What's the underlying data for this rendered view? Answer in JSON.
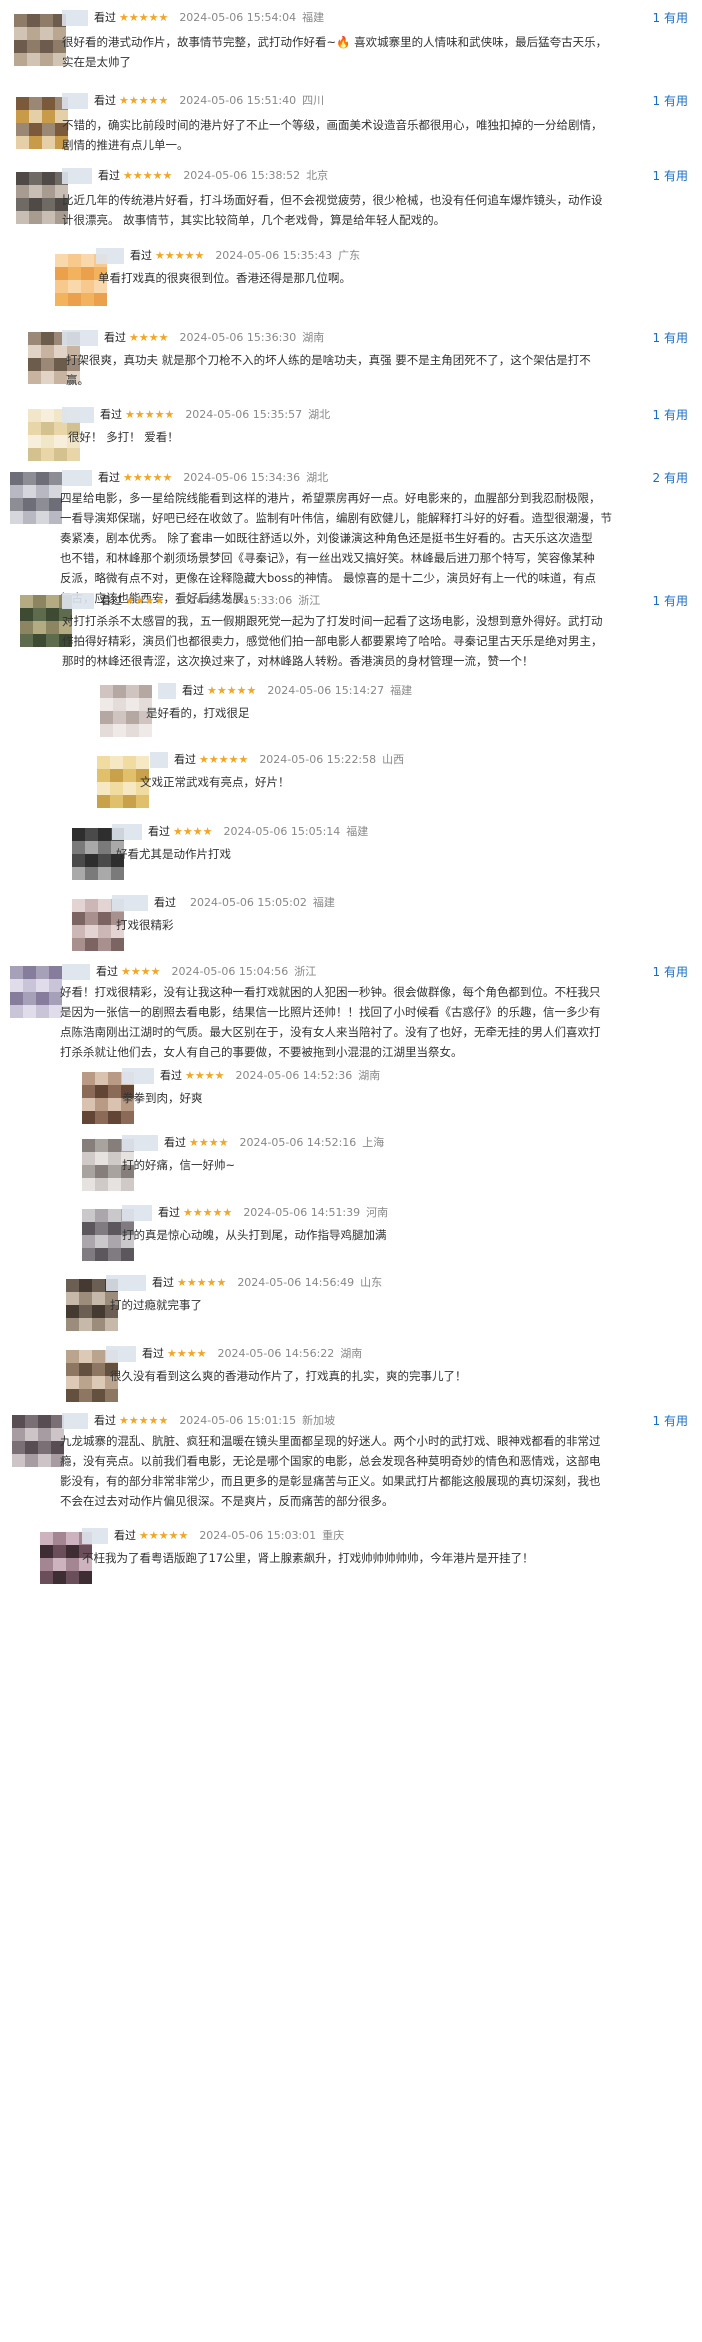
{
  "seen_label": "看过",
  "comments": [
    {
      "stars": "★★★★★",
      "time": "2024-05-06 15:54:04",
      "location": "福建",
      "useful": "1 有用",
      "lines": [
        "很好看的港式动作片，故事情节完整，武打动作好看~🔥 喜欢城寨里的人情味和武侠味，最后猛夸古天乐，",
        "实在是太帅了"
      ]
    },
    {
      "stars": "★★★★★",
      "time": "2024-05-06 15:51:40",
      "location": "四川",
      "useful": "1 有用",
      "lines": [
        "不错的，确实比前段时间的港片好了不止一个等级，画面美术设造音乐都很用心，唯独扣掉的一分给剧情，",
        "剧情的推进有点儿单一。"
      ]
    },
    {
      "stars": "★★★★★",
      "time": "2024-05-06 15:38:52",
      "location": "北京",
      "useful": "1 有用",
      "lines": [
        "比近几年的传统港片好看，打斗场面好看，但不会视觉疲劳，很少枪械，也没有任何追车爆炸镜头，动作设",
        "计很漂亮。 故事情节，其实比较简单，几个老戏骨，算是给年轻人配戏的。"
      ]
    },
    {
      "stars": "★★★★★",
      "time": "2024-05-06 15:35:43",
      "location": "广东",
      "useful": "",
      "lines": [
        "单看打戏真的很爽很到位。香港还得是那几位啊。"
      ]
    },
    {
      "stars": "★★★★",
      "time": "2024-05-06 15:36:30",
      "location": "湖南",
      "useful": "1 有用",
      "lines": [
        "打架很爽，真功夫 就是那个刀枪不入的坏人练的是啥功夫，真强 要不是主角团死不了，这个架估是打不",
        "赢。"
      ]
    },
    {
      "stars": "★★★★★",
      "time": "2024-05-06 15:35:57",
      "location": "湖北",
      "useful": "1 有用",
      "lines": [
        "很好！ 多打！ 爱看！"
      ]
    },
    {
      "stars": "★★★★★",
      "time": "2024-05-06 15:34:36",
      "location": "湖北",
      "useful": "2 有用",
      "lines": [
        "四星给电影，多一星给院线能看到这样的港片，希望票房再好一点。好电影来的，血腥部分到我忍耐极限，",
        "一看导演郑保瑞，好吧已经在收敛了。监制有叶伟信，编剧有欧健儿，能解释打斗好的好看。造型很潮漫，节",
        "奏紧凑，剧本优秀。 除了套串一如既往舒适以外，刘俊谦演这种角色还是挺书生好看的。古天乐这次造型",
        "也不错，和林峰那个剃须场景梦回《寻秦记》，有一丝出戏又搞好笑。林峰最后进刀那个特写，笑容像某种",
        "反派，略微有点不对，更像在诠释隐藏大boss的神情。 最惊喜的是十二少，演员好有上一代的味道，有点",
        "复古，应该也能西安，看好后续发展。"
      ]
    },
    {
      "stars": "★★★★",
      "time": "2024-05-06 15:33:06",
      "location": "浙江",
      "useful": "1 有用",
      "lines": [
        "对打打杀杀不太感冒的我，五一假期跟死党一起为了打发时间一起看了这场电影，没想到意外得好。武打动",
        "作拍得好精彩，演员们也都很卖力，感觉他们拍一部电影人都要累垮了哈哈。寻秦记里古天乐是绝对男主，",
        "那时的林峰还很青涩，这次换过来了，对林峰路人转粉。香港演员的身材管理一流，赞一个！"
      ]
    },
    {
      "stars": "★★★★★",
      "time": "2024-05-06 15:14:27",
      "location": "福建",
      "useful": "",
      "lines": [
        "是好看的，打戏很足"
      ]
    },
    {
      "stars": "★★★★★",
      "time": "2024-05-06 15:22:58",
      "location": "山西",
      "useful": "",
      "lines": [
        "文戏正常武戏有亮点，好片！"
      ]
    },
    {
      "stars": "★★★★",
      "time": "2024-05-06 15:05:14",
      "location": "福建",
      "useful": "",
      "lines": [
        "好看尤其是动作片打戏"
      ]
    },
    {
      "stars": "",
      "time": "2024-05-06 15:05:02",
      "location": "福建",
      "useful": "",
      "lines": [
        "打戏很精彩"
      ]
    },
    {
      "stars": "★★★★",
      "time": "2024-05-06 15:04:56",
      "location": "浙江",
      "useful": "1 有用",
      "lines": [
        "好看！打戏很精彩，没有让我这种一看打戏就困的人犯困一秒钟。很会做群像，每个角色都到位。不枉我只",
        "是因为一张信一的剧照去看电影，结果信一比照片还帅！！找回了小时候看《古惑仔》的乐趣，信一多少有",
        "点陈浩南刚出江湖时的气质。最大区别在于，没有女人来当陪衬了。没有了也好，无牵无挂的男人们喜欢打",
        "打杀杀就让他们去，女人有自己的事要做，不要被拖到小混混的江湖里当祭女。"
      ]
    },
    {
      "stars": "★★★★",
      "time": "2024-05-06 14:52:36",
      "location": "湖南",
      "useful": "",
      "lines": [
        "拳拳到肉，好爽"
      ]
    },
    {
      "stars": "★★★★",
      "time": "2024-05-06 14:52:16",
      "location": "上海",
      "useful": "",
      "lines": [
        "打的好痛，信一好帅~"
      ]
    },
    {
      "stars": "★★★★★",
      "time": "2024-05-06 14:51:39",
      "location": "河南",
      "useful": "",
      "lines": [
        "打的真是惊心动魄，从头打到尾，动作指导鸡腿加满"
      ]
    },
    {
      "stars": "★★★★★",
      "time": "2024-05-06 14:56:49",
      "location": "山东",
      "useful": "",
      "lines": [
        "打的过瘾就完事了"
      ]
    },
    {
      "stars": "★★★★",
      "time": "2024-05-06 14:56:22",
      "location": "湖南",
      "useful": "",
      "lines": [
        "很久没有看到这么爽的香港动作片了，打戏真的扎实，爽的完事儿了！"
      ]
    },
    {
      "stars": "★★★★★",
      "time": "2024-05-06 15:01:15",
      "location": "新加坡",
      "useful": "1 有用",
      "lines": [
        "九龙城寨的混乱、肮脏、疯狂和温暖在镜头里面都呈现的好迷人。两个小时的武打戏、眼神戏都看的非常过",
        "瘾，没有亮点。以前我们看电影，无论是哪个国家的电影，总会发现各种莫明奇妙的情色和恶情戏，这部电",
        "影没有，有的部分非常非常少，而且更多的是彰显痛苦与正义。如果武打片都能这般展现的真切深刻，我也",
        "不会在过去对动作片偏见很深。不是爽片，反而痛苦的部分很多。"
      ]
    },
    {
      "stars": "★★★★★",
      "time": "2024-05-06 15:03:01",
      "location": "重庆",
      "useful": "",
      "lines": [
        "不枉我为了看粤语版跑了17公里，肾上腺素飙升，打戏帅帅帅帅帅，今年港片是开挂了！"
      ]
    }
  ]
}
